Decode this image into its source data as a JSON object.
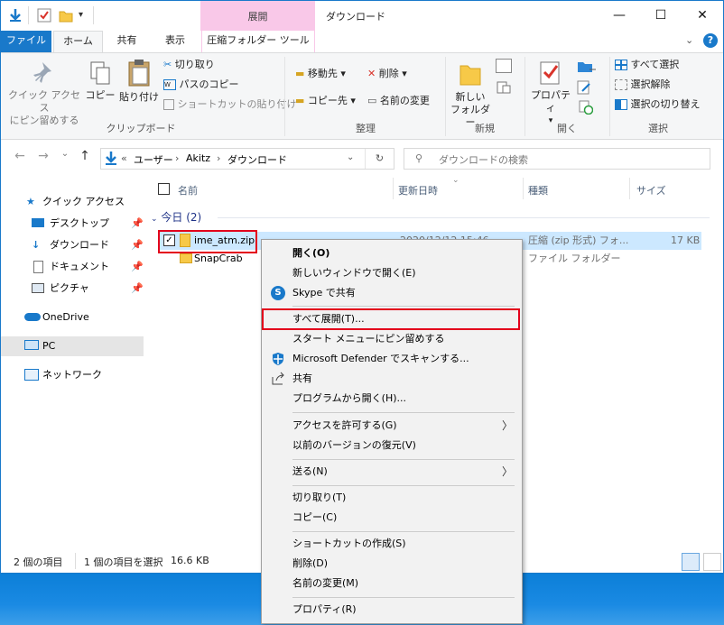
{
  "window": {
    "title": "ダウンロード"
  },
  "context_tab": {
    "label": "展開"
  },
  "tabs": [
    "ファイル",
    "ホーム",
    "共有",
    "表示",
    "圧縮フォルダー ツール"
  ],
  "ribbon": {
    "clipboard": {
      "pin_line1": "クイック アクセス",
      "pin_line2": "にピン留めする",
      "copy": "コピー",
      "paste": "貼り付け",
      "cut": "切り取り",
      "copy_path": "パスのコピー",
      "paste_shortcut": "ショートカットの貼り付け",
      "label": "クリップボード"
    },
    "organize": {
      "move_to": "移動先",
      "delete": "削除",
      "copy_to": "コピー先",
      "rename": "名前の変更",
      "label": "整理"
    },
    "new": {
      "new_folder_line1": "新しい",
      "new_folder_line2": "フォルダー",
      "label": "新規"
    },
    "open": {
      "properties": "プロパティ",
      "label": "開く"
    },
    "select": {
      "select_all": "すべて選択",
      "select_none": "選択解除",
      "invert": "選択の切り替え",
      "label": "選択"
    }
  },
  "address": {
    "overflow": "«",
    "crumbs": [
      "ユーザー",
      "Akitz",
      "ダウンロード"
    ],
    "search_placeholder": "ダウンロードの検索"
  },
  "nav": {
    "quick_access": "クイック アクセス",
    "desktop": "デスクトップ",
    "downloads": "ダウンロード",
    "documents": "ドキュメント",
    "pictures": "ピクチャ",
    "onedrive": "OneDrive",
    "pc": "PC",
    "network": "ネットワーク"
  },
  "columns": {
    "name": "名前",
    "date": "更新日時",
    "type": "種類",
    "size": "サイズ"
  },
  "group": {
    "label": "今日 (2)"
  },
  "files": [
    {
      "name": "ime_atm.zip",
      "date": "2020/12/12 15:46",
      "type": "圧縮 (zip 形式) フォ...",
      "size": "17 KB"
    },
    {
      "name": "SnapCrab",
      "date": "",
      "type": "ファイル フォルダー",
      "size": ""
    }
  ],
  "status": {
    "count": "2 個の項目",
    "selected": "1 個の項目を選択",
    "size": "16.6 KB"
  },
  "context_menu": {
    "open": "開く(O)",
    "open_new_window": "新しいウィンドウで開く(E)",
    "skype_share": "Skype で共有",
    "extract_all": "すべて展開(T)...",
    "pin_start": "スタート メニューにピン留めする",
    "defender_scan": "Microsoft Defender でスキャンする...",
    "share": "共有",
    "open_with": "プログラムから開く(H)...",
    "give_access": "アクセスを許可する(G)",
    "restore_versions": "以前のバージョンの復元(V)",
    "send_to": "送る(N)",
    "cut": "切り取り(T)",
    "copy": "コピー(C)",
    "create_shortcut": "ショートカットの作成(S)",
    "delete": "削除(D)",
    "rename": "名前の変更(M)",
    "properties": "プロパティ(R)"
  },
  "colors": {
    "accent": "#1979ca",
    "context_tab": "#f9c8e8",
    "highlight": "#e3001b",
    "selection": "#cce8ff"
  }
}
